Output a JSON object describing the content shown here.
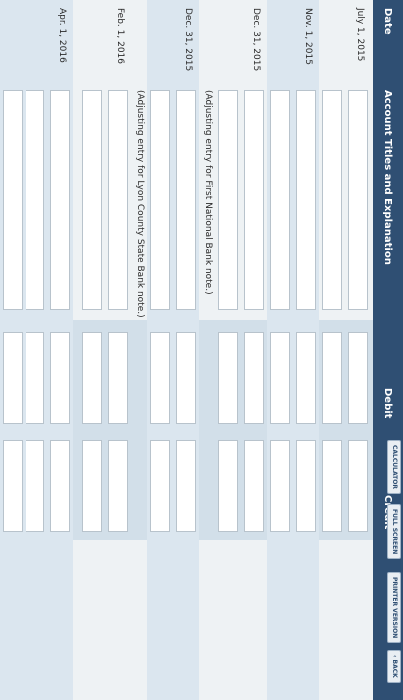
{
  "header": {
    "date": "Date",
    "account": "Account Titles and Explanation",
    "debit": "Debit",
    "credit": "Credit"
  },
  "top_buttons": {
    "calculator": "CALCULATOR",
    "full_screen": "FULL SCREEN",
    "printer_version": "PRINTER VERSION",
    "back": "‹ BACK"
  },
  "entries": {
    "july": "July 1, 2015",
    "nov": "Nov. 1, 2015",
    "dec1": "Dec. 31, 2015",
    "note1": "(Adjusting entry for First National Bank note.)",
    "dec2": "Dec. 31, 2015",
    "note2": "(Adjusting entry for Lyon County State Bank note.)",
    "feb": "Feb. 1, 2016",
    "apr": "Apr. 1, 2016"
  }
}
